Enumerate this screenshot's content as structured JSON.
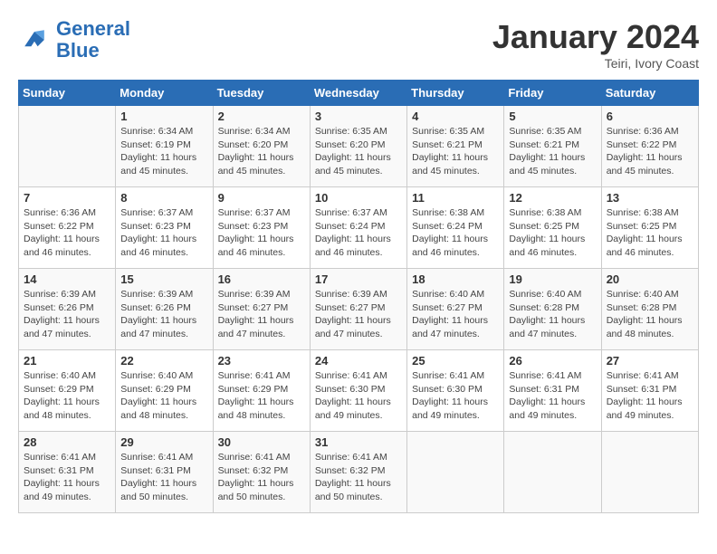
{
  "header": {
    "logo_line1": "General",
    "logo_line2": "Blue",
    "month": "January 2024",
    "location": "Teiri, Ivory Coast"
  },
  "weekdays": [
    "Sunday",
    "Monday",
    "Tuesday",
    "Wednesday",
    "Thursday",
    "Friday",
    "Saturday"
  ],
  "weeks": [
    [
      {
        "day": "",
        "info": ""
      },
      {
        "day": "1",
        "info": "Sunrise: 6:34 AM\nSunset: 6:19 PM\nDaylight: 11 hours and 45 minutes."
      },
      {
        "day": "2",
        "info": "Sunrise: 6:34 AM\nSunset: 6:20 PM\nDaylight: 11 hours and 45 minutes."
      },
      {
        "day": "3",
        "info": "Sunrise: 6:35 AM\nSunset: 6:20 PM\nDaylight: 11 hours and 45 minutes."
      },
      {
        "day": "4",
        "info": "Sunrise: 6:35 AM\nSunset: 6:21 PM\nDaylight: 11 hours and 45 minutes."
      },
      {
        "day": "5",
        "info": "Sunrise: 6:35 AM\nSunset: 6:21 PM\nDaylight: 11 hours and 45 minutes."
      },
      {
        "day": "6",
        "info": "Sunrise: 6:36 AM\nSunset: 6:22 PM\nDaylight: 11 hours and 45 minutes."
      }
    ],
    [
      {
        "day": "7",
        "info": "Sunrise: 6:36 AM\nSunset: 6:22 PM\nDaylight: 11 hours and 46 minutes."
      },
      {
        "day": "8",
        "info": "Sunrise: 6:37 AM\nSunset: 6:23 PM\nDaylight: 11 hours and 46 minutes."
      },
      {
        "day": "9",
        "info": "Sunrise: 6:37 AM\nSunset: 6:23 PM\nDaylight: 11 hours and 46 minutes."
      },
      {
        "day": "10",
        "info": "Sunrise: 6:37 AM\nSunset: 6:24 PM\nDaylight: 11 hours and 46 minutes."
      },
      {
        "day": "11",
        "info": "Sunrise: 6:38 AM\nSunset: 6:24 PM\nDaylight: 11 hours and 46 minutes."
      },
      {
        "day": "12",
        "info": "Sunrise: 6:38 AM\nSunset: 6:25 PM\nDaylight: 11 hours and 46 minutes."
      },
      {
        "day": "13",
        "info": "Sunrise: 6:38 AM\nSunset: 6:25 PM\nDaylight: 11 hours and 46 minutes."
      }
    ],
    [
      {
        "day": "14",
        "info": "Sunrise: 6:39 AM\nSunset: 6:26 PM\nDaylight: 11 hours and 47 minutes."
      },
      {
        "day": "15",
        "info": "Sunrise: 6:39 AM\nSunset: 6:26 PM\nDaylight: 11 hours and 47 minutes."
      },
      {
        "day": "16",
        "info": "Sunrise: 6:39 AM\nSunset: 6:27 PM\nDaylight: 11 hours and 47 minutes."
      },
      {
        "day": "17",
        "info": "Sunrise: 6:39 AM\nSunset: 6:27 PM\nDaylight: 11 hours and 47 minutes."
      },
      {
        "day": "18",
        "info": "Sunrise: 6:40 AM\nSunset: 6:27 PM\nDaylight: 11 hours and 47 minutes."
      },
      {
        "day": "19",
        "info": "Sunrise: 6:40 AM\nSunset: 6:28 PM\nDaylight: 11 hours and 47 minutes."
      },
      {
        "day": "20",
        "info": "Sunrise: 6:40 AM\nSunset: 6:28 PM\nDaylight: 11 hours and 48 minutes."
      }
    ],
    [
      {
        "day": "21",
        "info": "Sunrise: 6:40 AM\nSunset: 6:29 PM\nDaylight: 11 hours and 48 minutes."
      },
      {
        "day": "22",
        "info": "Sunrise: 6:40 AM\nSunset: 6:29 PM\nDaylight: 11 hours and 48 minutes."
      },
      {
        "day": "23",
        "info": "Sunrise: 6:41 AM\nSunset: 6:29 PM\nDaylight: 11 hours and 48 minutes."
      },
      {
        "day": "24",
        "info": "Sunrise: 6:41 AM\nSunset: 6:30 PM\nDaylight: 11 hours and 49 minutes."
      },
      {
        "day": "25",
        "info": "Sunrise: 6:41 AM\nSunset: 6:30 PM\nDaylight: 11 hours and 49 minutes."
      },
      {
        "day": "26",
        "info": "Sunrise: 6:41 AM\nSunset: 6:31 PM\nDaylight: 11 hours and 49 minutes."
      },
      {
        "day": "27",
        "info": "Sunrise: 6:41 AM\nSunset: 6:31 PM\nDaylight: 11 hours and 49 minutes."
      }
    ],
    [
      {
        "day": "28",
        "info": "Sunrise: 6:41 AM\nSunset: 6:31 PM\nDaylight: 11 hours and 49 minutes."
      },
      {
        "day": "29",
        "info": "Sunrise: 6:41 AM\nSunset: 6:31 PM\nDaylight: 11 hours and 50 minutes."
      },
      {
        "day": "30",
        "info": "Sunrise: 6:41 AM\nSunset: 6:32 PM\nDaylight: 11 hours and 50 minutes."
      },
      {
        "day": "31",
        "info": "Sunrise: 6:41 AM\nSunset: 6:32 PM\nDaylight: 11 hours and 50 minutes."
      },
      {
        "day": "",
        "info": ""
      },
      {
        "day": "",
        "info": ""
      },
      {
        "day": "",
        "info": ""
      }
    ]
  ]
}
